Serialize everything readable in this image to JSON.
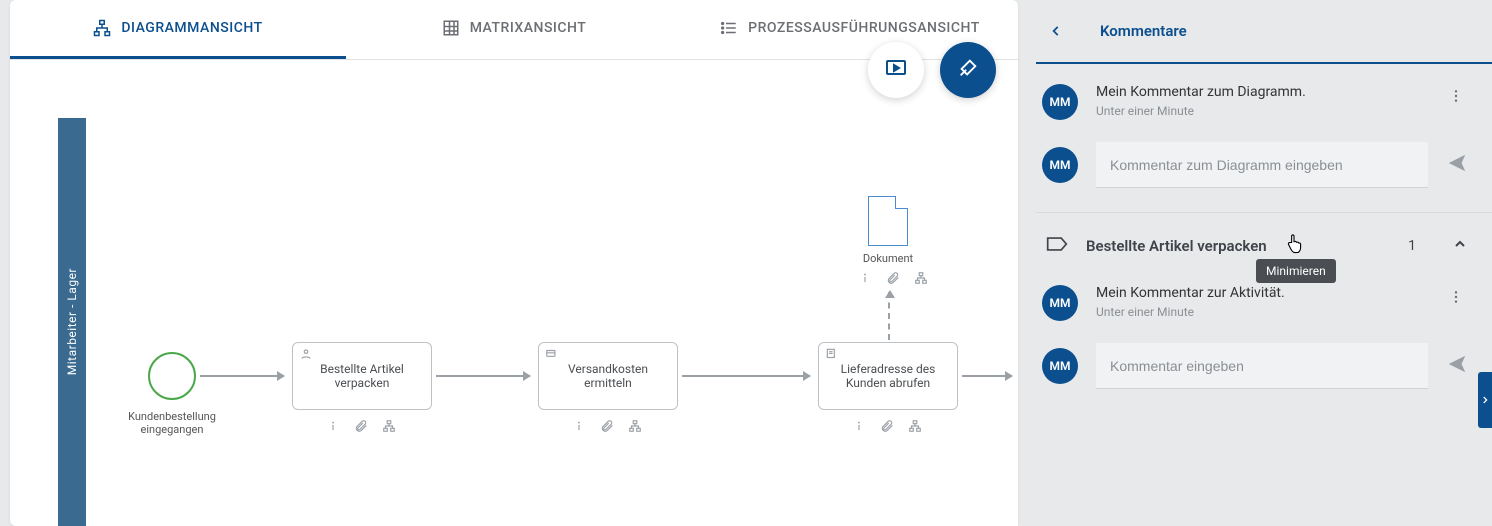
{
  "tabs": {
    "diagram": "DIAGRAMMANSICHT",
    "matrix": "MATRIXANSICHT",
    "process": "PROZESSAUSFÜHRUNGSANSICHT"
  },
  "lane": {
    "title": "Mitarbeiter - Lager"
  },
  "start_event": {
    "label": "Kundenbestellung eingegangen"
  },
  "tasks": {
    "t1": "Bestellte Artikel verpacken",
    "t2": "Versandkosten ermitteln",
    "t3": "Lieferadresse des Kunden abrufen"
  },
  "doc": {
    "label": "Dokument"
  },
  "side": {
    "title": "Kommentare",
    "avatar": "MM",
    "diagram_comment": {
      "text": "Mein Kommentar zum Diagramm.",
      "time": "Unter einer Minute"
    },
    "diagram_input_placeholder": "Kommentar zum Diagramm eingeben",
    "activity": {
      "title": "Bestellte Artikel verpacken",
      "count": "1"
    },
    "activity_comment": {
      "text": "Mein Kommentar zur Aktivität.",
      "time": "Unter einer Minute"
    },
    "activity_input_placeholder": "Kommentar eingeben",
    "tooltip": "Minimieren"
  }
}
